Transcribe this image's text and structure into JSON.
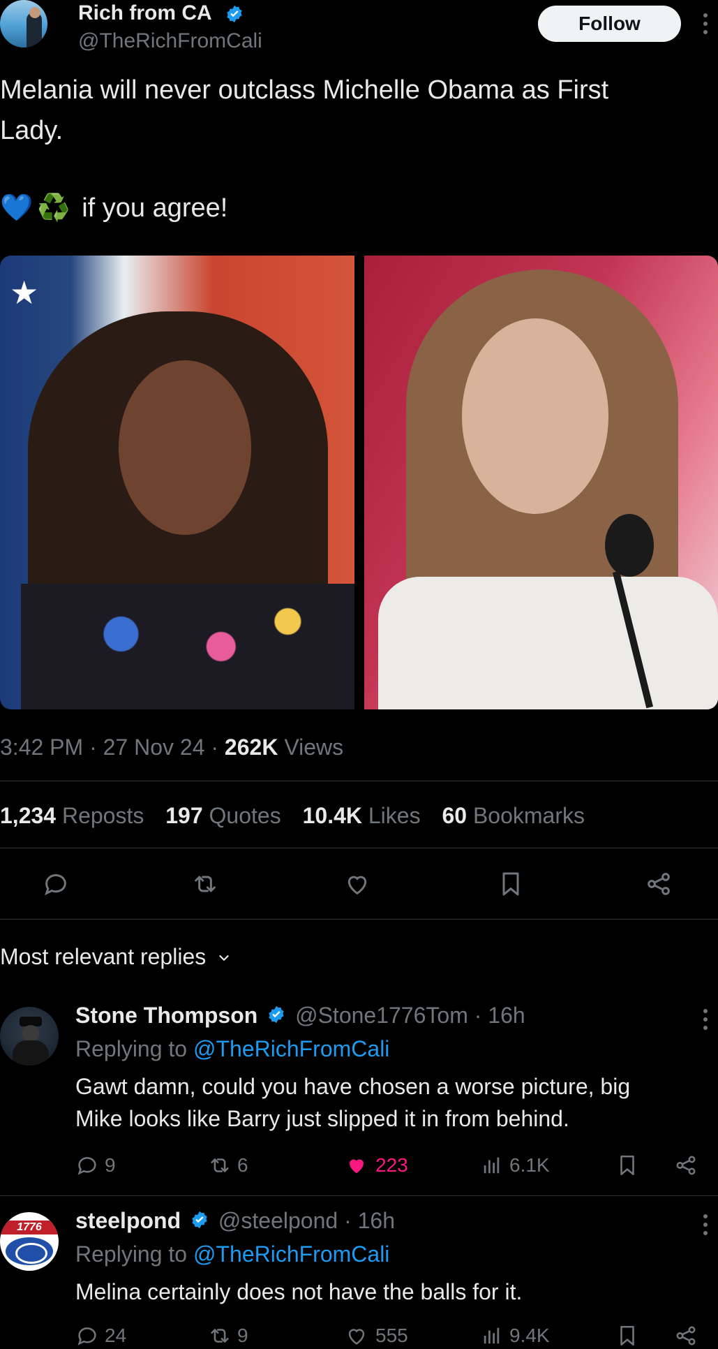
{
  "post": {
    "author_name": "Rich from CA",
    "author_handle": "@TheRichFromCali",
    "follow_label": "Follow",
    "text_line1": "Melania will never outclass Michelle Obama as First",
    "text_line2": "Lady.",
    "text_line3": "if you agree!",
    "emoji1": "💙",
    "emoji2": "♻️",
    "timestamp": "3:42 PM · 27 Nov 24 · ",
    "views_count": "262K",
    "views_label": " Views",
    "stats": {
      "reposts_count": "1,234",
      "reposts_label": "Reposts",
      "quotes_count": "197",
      "quotes_label": "Quotes",
      "likes_count": "10.4K",
      "likes_label": "Likes",
      "bookmarks_count": "60",
      "bookmarks_label": "Bookmarks"
    }
  },
  "replies_header": "Most relevant replies",
  "replies": [
    {
      "name": "Stone Thompson",
      "handle": "@Stone1776Tom",
      "time": " · 16h",
      "replying_prefix": "Replying to ",
      "replying_to": "@TheRichFromCali",
      "text_line1": "Gawt damn, could you have chosen a worse picture, big",
      "text_line2": "Mike looks like Barry just slipped it in from behind.",
      "comments": "9",
      "reposts": "6",
      "likes": "223",
      "views": "6.1K"
    },
    {
      "name": "steelpond",
      "handle": "@steelpond",
      "time": " · 16h",
      "replying_prefix": "Replying to ",
      "replying_to": "@TheRichFromCali",
      "text_line1": "Melina certainly does not have the balls for it.",
      "comments": "24",
      "reposts": "9",
      "likes": "555",
      "views": "9.4K",
      "avatar_text": "1776"
    }
  ],
  "colors": {
    "background": "#000000",
    "text": "#e7e9ea",
    "muted": "#71767b",
    "link": "#1d9bf0",
    "liked": "#f91880",
    "divider": "#2f3336"
  }
}
